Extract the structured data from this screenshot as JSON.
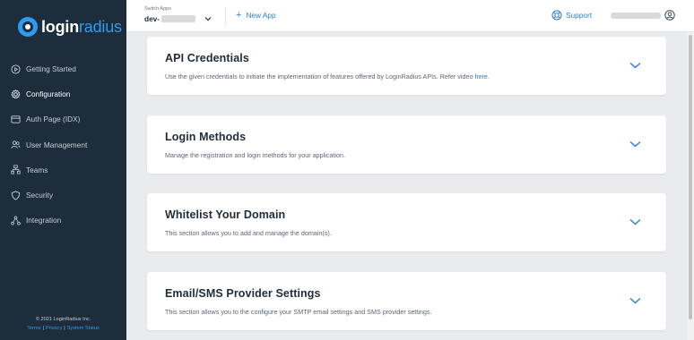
{
  "brand": {
    "part1": "login",
    "part2": "radius"
  },
  "sidebar": {
    "items": [
      {
        "label": "Getting Started",
        "icon": "play-circle-icon",
        "active": false
      },
      {
        "label": "Configuration",
        "icon": "gear-icon",
        "active": true
      },
      {
        "label": "Auth Page (IDX)",
        "icon": "browser-icon",
        "active": false
      },
      {
        "label": "User Management",
        "icon": "users-icon",
        "active": false
      },
      {
        "label": "Teams",
        "icon": "team-icon",
        "active": false
      },
      {
        "label": "Security",
        "icon": "shield-icon",
        "active": false
      },
      {
        "label": "Integration",
        "icon": "integration-icon",
        "active": false
      }
    ],
    "footer": {
      "copyright": "© 2021 LoginRadius Inc.",
      "links": [
        "Terms",
        "Privacy",
        "System Status"
      ],
      "separator": "|"
    }
  },
  "header": {
    "switch_label": "Switch Apps",
    "app_name": "dev-",
    "new_app_label": "New App",
    "support_label": "Support"
  },
  "cards": [
    {
      "title": "API Credentials",
      "description": "Use the given credentials to initiate the implementation of features offered by LoginRadius APIs. Refer video ",
      "link": "here",
      "suffix": "."
    },
    {
      "title": "Login Methods",
      "description": "Manage the registration and login methods for your application."
    },
    {
      "title": "Whitelist Your Domain",
      "description": "This section allows you to add and manage the domain(s)."
    },
    {
      "title": "Email/SMS Provider Settings",
      "description": "This section allows you to the configure your SMTP email settings and SMS provider settings."
    }
  ],
  "colors": {
    "sidebar_bg": "#1d2d3c",
    "accent": "#2b7fd9",
    "page_bg": "#eaebec"
  }
}
